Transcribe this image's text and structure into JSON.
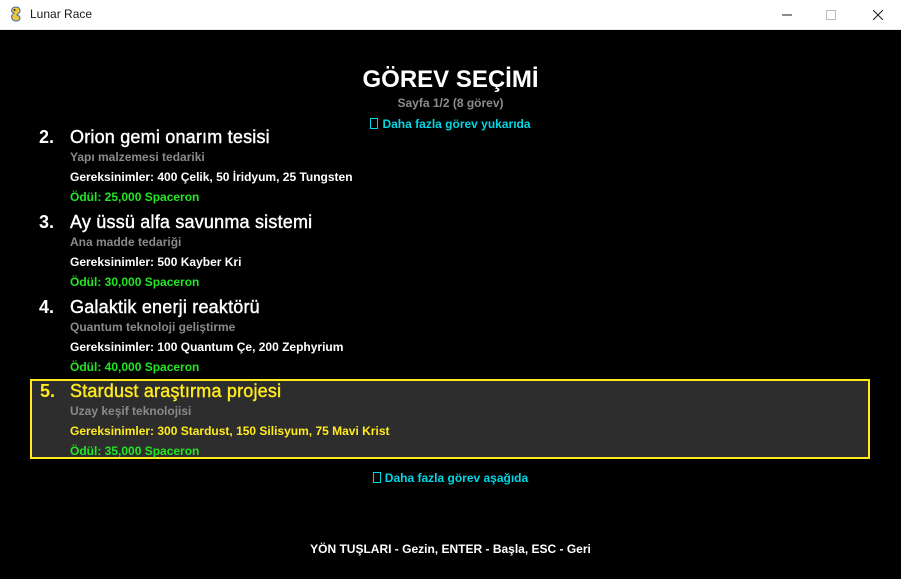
{
  "window": {
    "title": "Lunar Race",
    "icon": "pygame-snake-icon",
    "minimize_icon": "minimize-icon",
    "maximize_icon": "maximize-icon",
    "close_icon": "close-icon"
  },
  "screen": {
    "title": "GÖREV SEÇİMİ",
    "page_info": "Sayfa 1/2 (8 görev)",
    "more_up": "Daha fazla görev yukarıda",
    "more_down": "Daha fazla görev aşağıda",
    "footer": "YÖN TUŞLARI - Gezin, ENTER - Başla, ESC - Geri"
  },
  "missions": [
    {
      "number": "2.",
      "name": "Orion gemi onarım tesisi",
      "subtitle": "Yapı malzemesi tedariki",
      "requirements": "Gereksinimler: 400 Çelik, 50 İridyum, 25 Tungsten",
      "reward": "Ödül: 25,000 Spaceron",
      "selected": false
    },
    {
      "number": "3.",
      "name": "Ay üssü alfa savunma sistemi",
      "subtitle": "Ana madde tedariği",
      "requirements": "Gereksinimler: 500 Kayber Kri",
      "reward": "Ödül: 30,000 Spaceron",
      "selected": false
    },
    {
      "number": "4.",
      "name": "Galaktik enerji reaktörü",
      "subtitle": "Quantum teknoloji geliştirme",
      "requirements": "Gereksinimler: 100 Quantum Çe, 200 Zephyrium",
      "reward": "Ödül: 40,000 Spaceron",
      "selected": false
    },
    {
      "number": "5.",
      "name": "Stardust araştırma projesi",
      "subtitle": "Uzay keşif teknolojisi",
      "requirements": "Gereksinimler: 300 Stardust, 150 Silisyum, 75 Mavi Krist",
      "reward": "Ödül: 35,000 Spaceron",
      "selected": true
    }
  ],
  "colors": {
    "background": "#000000",
    "title": "#ffffff",
    "subtitle_gray": "#8a8a8a",
    "hint_cyan": "#00d7e6",
    "reward_green": "#22e622",
    "selected_yellow": "#ffeb1e",
    "selected_bg": "#2d2d2d"
  }
}
